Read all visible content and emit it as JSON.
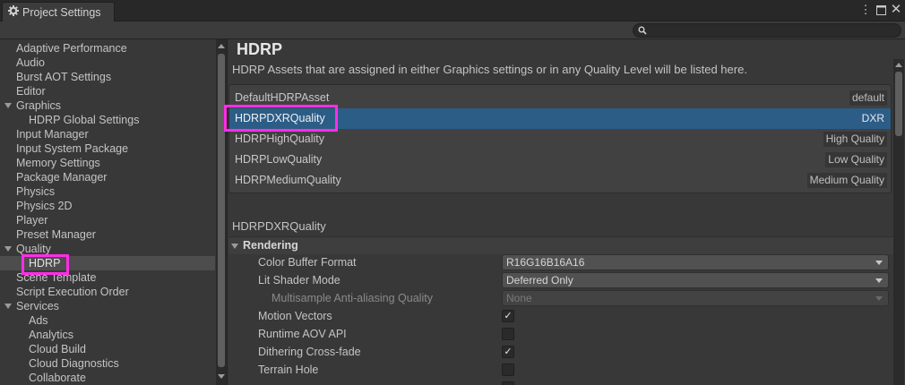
{
  "window": {
    "tab_title": "Project Settings",
    "icon": "gear-icon",
    "menu_icon": "kebab-menu-icon",
    "maximize_icon": "maximize-icon",
    "close_icon": "close-icon"
  },
  "search": {
    "placeholder": "",
    "icon": "search-icon"
  },
  "sidebar": {
    "items": [
      {
        "label": "Adaptive Performance"
      },
      {
        "label": "Audio"
      },
      {
        "label": "Burst AOT Settings"
      },
      {
        "label": "Editor"
      },
      {
        "label": "Graphics"
      },
      {
        "label": "HDRP Global Settings"
      },
      {
        "label": "Input Manager"
      },
      {
        "label": "Input System Package"
      },
      {
        "label": "Memory Settings"
      },
      {
        "label": "Package Manager"
      },
      {
        "label": "Physics"
      },
      {
        "label": "Physics 2D"
      },
      {
        "label": "Player"
      },
      {
        "label": "Preset Manager"
      },
      {
        "label": "Quality"
      },
      {
        "label": "HDRP"
      },
      {
        "label": "Scene Template"
      },
      {
        "label": "Script Execution Order"
      },
      {
        "label": "Services"
      },
      {
        "label": "Ads"
      },
      {
        "label": "Analytics"
      },
      {
        "label": "Cloud Build"
      },
      {
        "label": "Cloud Diagnostics"
      },
      {
        "label": "Collaborate"
      }
    ],
    "selected": "HDRP"
  },
  "main": {
    "title": "HDRP",
    "description": "HDRP Assets that are assigned in either Graphics settings or in any Quality Level will be listed here.",
    "assets": [
      {
        "name": "DefaultHDRPAsset",
        "level": "default"
      },
      {
        "name": "HDRPDXRQuality",
        "level": "DXR"
      },
      {
        "name": "HDRPHighQuality",
        "level": "High Quality"
      },
      {
        "name": "HDRPLowQuality",
        "level": "Low Quality"
      },
      {
        "name": "HDRPMediumQuality",
        "level": "Medium Quality"
      }
    ],
    "selected_asset": "HDRPDXRQuality",
    "asset_heading": "HDRPDXRQuality",
    "section": "Rendering",
    "properties": {
      "color_buffer_format": {
        "label": "Color Buffer Format",
        "value": "R16G16B16A16"
      },
      "lit_shader_mode": {
        "label": "Lit Shader Mode",
        "value": "Deferred Only"
      },
      "msaa_quality": {
        "label": "Multisample Anti-aliasing Quality",
        "value": "None"
      },
      "motion_vectors": {
        "label": "Motion Vectors",
        "checked": true
      },
      "runtime_aov_api": {
        "label": "Runtime AOV API",
        "checked": false
      },
      "dithering_cross_fade": {
        "label": "Dithering Cross-fade",
        "checked": true
      },
      "terrain_hole": {
        "label": "Terrain Hole",
        "checked": false
      }
    }
  },
  "highlight_color": "#ff2de8",
  "selection_color": "#2c5d87"
}
